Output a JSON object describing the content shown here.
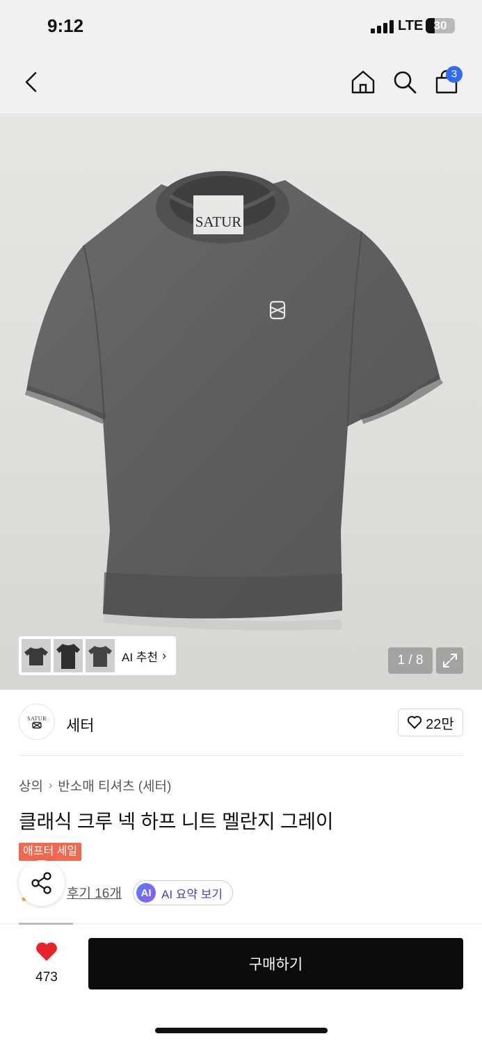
{
  "status_bar": {
    "time": "9:12",
    "network": "LTE",
    "battery_level": "30",
    "battery_fraction": 0.3
  },
  "nav": {
    "back_icon": "chevron-left-icon",
    "home_icon": "home-icon",
    "search_icon": "search-icon",
    "cart_icon": "shopping-bag-icon",
    "cart_count": "3",
    "badge_color": "#2f6bf6"
  },
  "gallery": {
    "label_text": "SATUR",
    "ai_recommend_label": "AI 추천",
    "counter": "1 / 8",
    "expand_icon": "expand-icon"
  },
  "brand": {
    "logo_text": "SATUR",
    "name": "세터",
    "likes": "22만"
  },
  "product": {
    "breadcrumb": [
      "상의",
      "반소매 티셔츠 (세터)"
    ],
    "title": "클래식 크루 넥 하프 니트 멜란지 그레이",
    "sale_tag": "애프터 세일",
    "sale_color": "#f0684f",
    "review_link": "후기 16개",
    "ai_summary_badge": "AI",
    "ai_summary_label": "AI 요약 보기"
  },
  "bottom_bar": {
    "wish_count": "473",
    "buy_label": "구매하기",
    "heart_color": "#e8232d"
  }
}
